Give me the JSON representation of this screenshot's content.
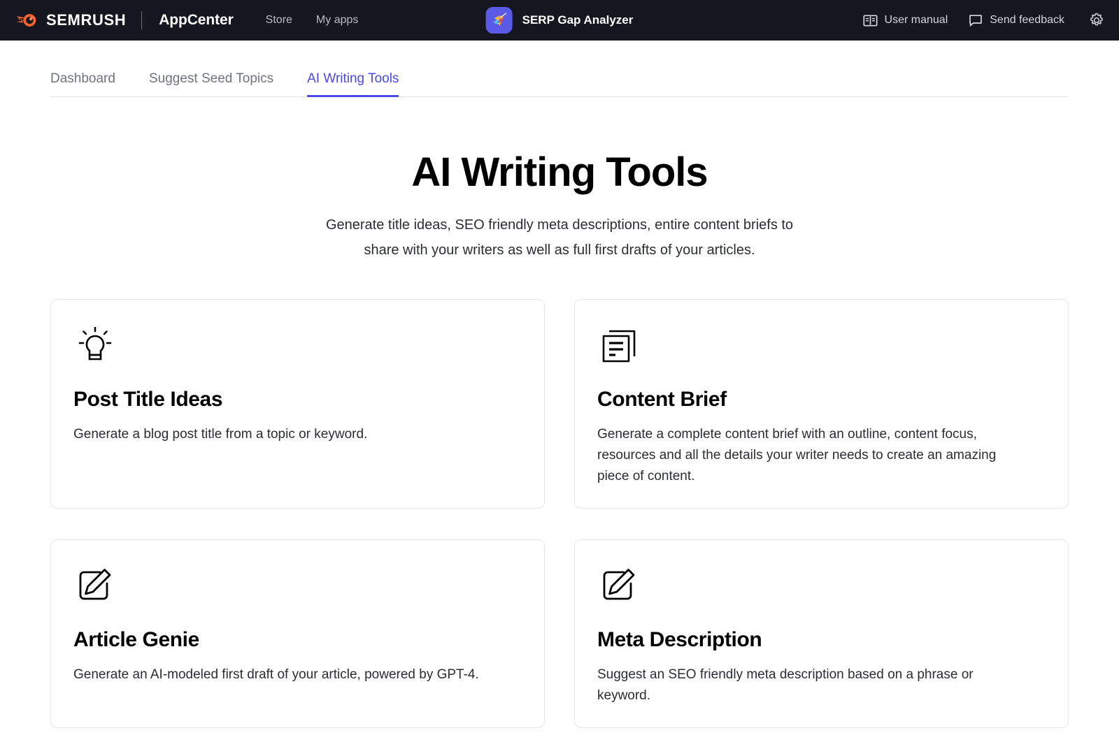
{
  "topbar": {
    "brand_name": "SEMRUSH",
    "brand_product": "AppCenter",
    "nav": [
      {
        "label": "Store",
        "name": "store"
      },
      {
        "label": "My apps",
        "name": "my-apps"
      }
    ],
    "app_title": "SERP Gap Analyzer",
    "app_icon_name": "hummingbird-app-icon",
    "actions": [
      {
        "label": "User manual",
        "icon": "book-icon",
        "name": "user-manual"
      },
      {
        "label": "Send feedback",
        "icon": "speech-bubble-icon",
        "name": "send-feedback"
      }
    ],
    "settings_icon": "gear-icon",
    "background_color": "#14171f"
  },
  "tabs": [
    {
      "label": "Dashboard",
      "active": false
    },
    {
      "label": "Suggest Seed Topics",
      "active": false
    },
    {
      "label": "AI Writing Tools",
      "active": true
    }
  ],
  "accent_color": "#4a4ae4",
  "hero": {
    "title": "AI Writing Tools",
    "subtitle_line1": "Generate title ideas, SEO friendly meta descriptions, entire content briefs to",
    "subtitle_line2": "share with your writers as well as full first drafts of your articles."
  },
  "cards": [
    {
      "title": "Post Title Ideas",
      "description": "Generate a blog post title from a topic or keyword.",
      "icon": "lightbulb-icon"
    },
    {
      "title": "Content Brief",
      "description": "Generate a complete content brief with an outline, content focus, resources and all the details your writer needs to create an amazing piece of content.",
      "icon": "documents-icon"
    },
    {
      "title": "Article Genie",
      "description": "Generate an AI-modeled first draft of your article, powered by GPT-4.",
      "icon": "edit-pencil-icon"
    },
    {
      "title": "Meta Description",
      "description": "Suggest an SEO friendly meta description based on a phrase or keyword.",
      "icon": "edit-pencil-icon"
    }
  ]
}
